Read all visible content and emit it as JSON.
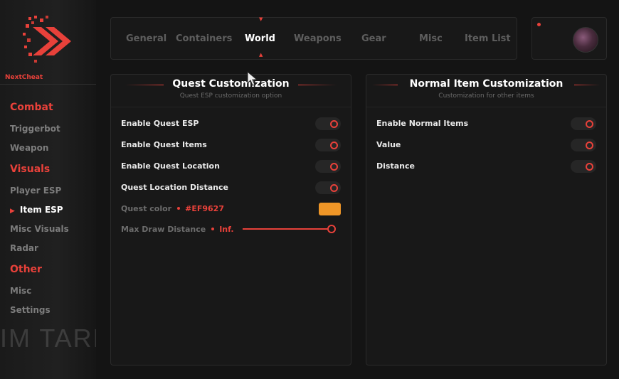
{
  "colors": {
    "accent": "#e8413a",
    "quest_color_swatch": "#EF9627"
  },
  "sidebar": {
    "brand": "NextCheat",
    "background_text": "IM TARK",
    "sections": [
      {
        "title": "Combat",
        "items": [
          "Triggerbot",
          "Weapon"
        ]
      },
      {
        "title": "Visuals",
        "items": [
          "Player ESP",
          "Item ESP",
          "Misc Visuals",
          "Radar"
        ]
      },
      {
        "title": "Other",
        "items": [
          "Misc",
          "Settings"
        ]
      }
    ],
    "active_item": "Item ESP"
  },
  "tabs": {
    "items": [
      "General",
      "Containers",
      "World",
      "Weapons",
      "Gear",
      "Misc",
      "Item List"
    ],
    "active": "World"
  },
  "quest_panel": {
    "title": "Quest Customization",
    "subtitle": "Quest ESP customization option",
    "toggles": [
      "Enable Quest ESP",
      "Enable Quest Items",
      "Enable Quest Location",
      "Quest Location Distance"
    ],
    "quest_color_label": "Quest color",
    "quest_color_value": "#EF9627",
    "max_draw_label": "Max Draw Distance",
    "max_draw_value": "Inf."
  },
  "normal_panel": {
    "title": "Normal Item Customization",
    "subtitle": "Customization for other items",
    "toggles": [
      "Enable Normal Items",
      "Value",
      "Distance"
    ]
  }
}
